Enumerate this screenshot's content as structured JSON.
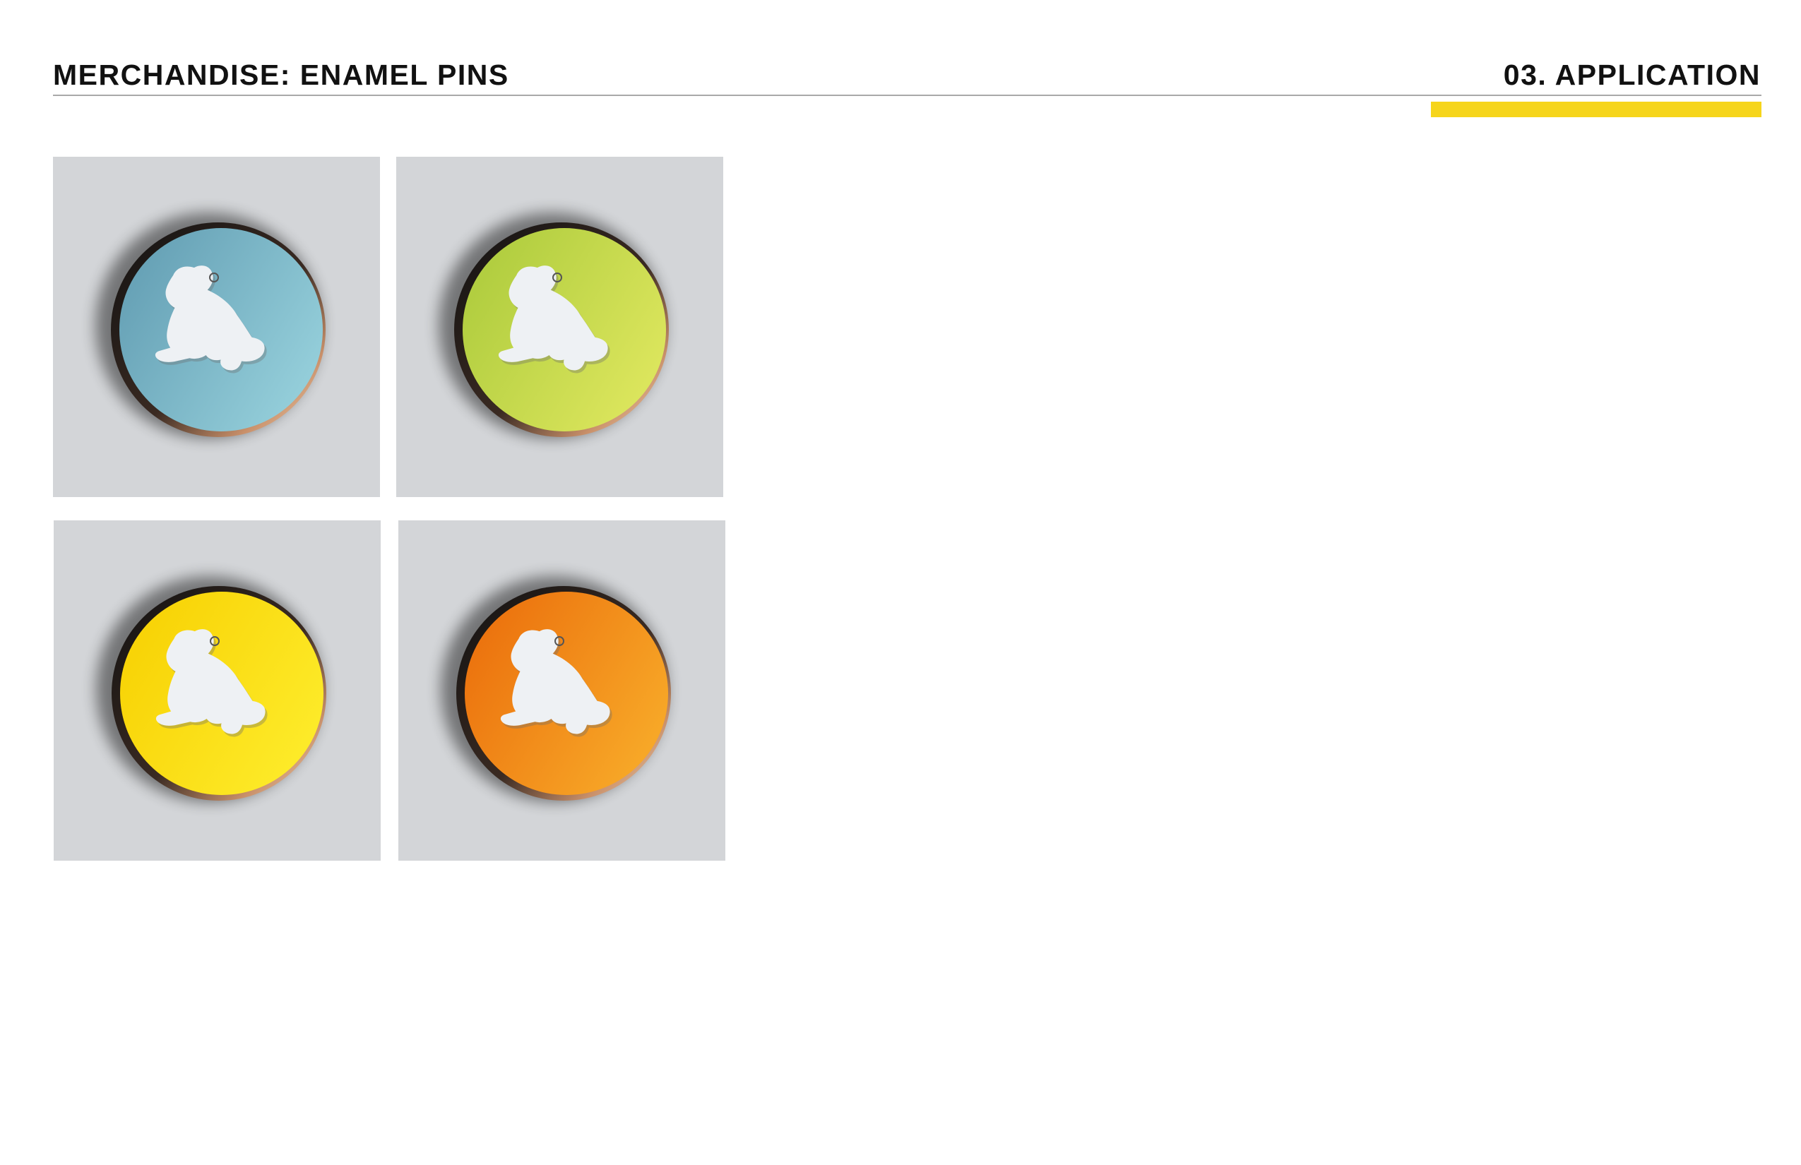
{
  "header": {
    "title": "MERCHANDISE: ENAMEL PINS",
    "section": "03. APPLICATION",
    "accent_color": "#f6d51b"
  },
  "pins": [
    {
      "icon": "frog-silhouette-icon",
      "enamel_color": "blue",
      "color_dark": "#5f9ab0",
      "color_light": "#93cdd9"
    },
    {
      "icon": "frog-silhouette-icon",
      "enamel_color": "green",
      "color_dark": "#a9c93a",
      "color_light": "#dbe55c"
    },
    {
      "icon": "frog-silhouette-icon",
      "enamel_color": "yellow",
      "color_dark": "#f7cf00",
      "color_light": "#fdea28"
    },
    {
      "icon": "frog-silhouette-icon",
      "enamel_color": "orange",
      "color_dark": "#ea6a0a",
      "color_light": "#f7a727"
    }
  ],
  "colors": {
    "tile_background": "#d3d5d8",
    "frog_fill": "#eef1f4",
    "metal_rim": "#c9906a"
  }
}
